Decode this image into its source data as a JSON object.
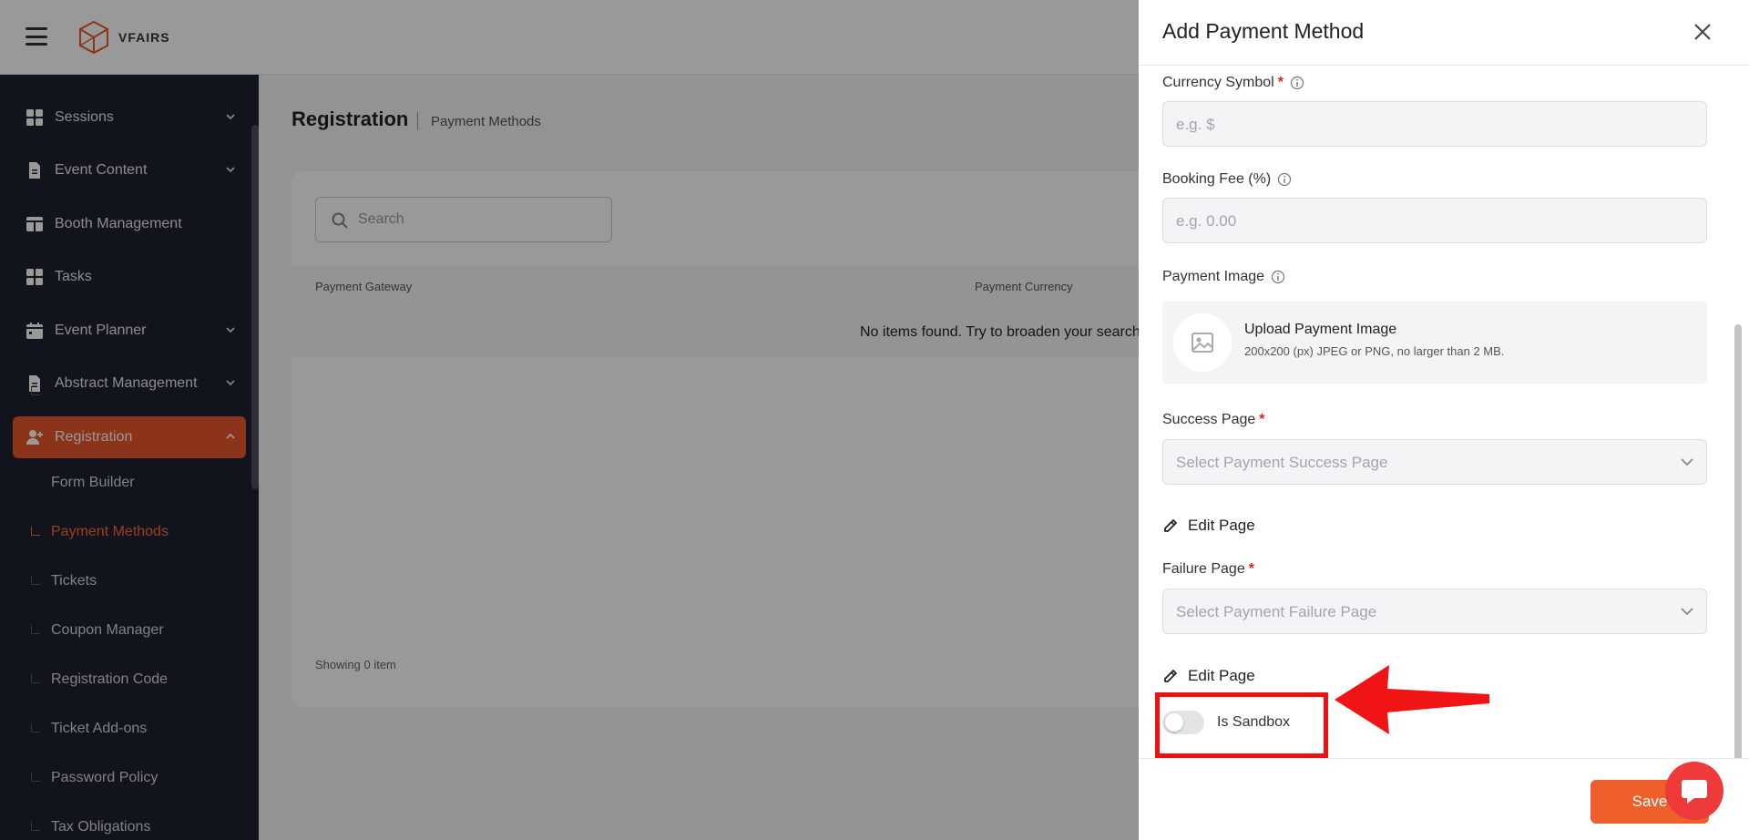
{
  "brand": {
    "logo_text": "VFAIRS"
  },
  "sidebar": {
    "items": [
      {
        "label": "Sessions",
        "icon": "grid-icon"
      },
      {
        "label": "Event Content",
        "icon": "document-icon"
      },
      {
        "label": "Booth Management",
        "icon": "booth-icon"
      },
      {
        "label": "Tasks",
        "icon": "grid-icon"
      },
      {
        "label": "Event Planner",
        "icon": "calendar-icon"
      },
      {
        "label": "Abstract Management",
        "icon": "document-icon"
      },
      {
        "label": "Registration",
        "icon": "user-plus-icon"
      }
    ],
    "sub_items": [
      {
        "label": "Form Builder"
      },
      {
        "label": "Payment Methods"
      },
      {
        "label": "Tickets"
      },
      {
        "label": "Coupon Manager"
      },
      {
        "label": "Registration Code"
      },
      {
        "label": "Ticket Add-ons"
      },
      {
        "label": "Password Policy"
      },
      {
        "label": "Tax Obligations"
      }
    ]
  },
  "main": {
    "title": "Registration",
    "breadcrumb": "Payment Methods",
    "search_placeholder": "Search",
    "columns": [
      "Payment Gateway",
      "Payment Currency"
    ],
    "empty_message": "No items found. Try to broaden your search",
    "showing": "Showing 0 item"
  },
  "drawer": {
    "title": "Add Payment Method",
    "currency_symbol": {
      "label": "Currency Symbol",
      "placeholder": "e.g. $"
    },
    "booking_fee": {
      "label": "Booking Fee (%)",
      "placeholder": "e.g. 0.00"
    },
    "payment_image": {
      "label": "Payment Image",
      "upload_title": "Upload Payment Image",
      "upload_hint": "200x200 (px) JPEG or PNG, no larger than 2 MB."
    },
    "success_page": {
      "label": "Success Page",
      "placeholder": "Select Payment Success Page"
    },
    "failure_page": {
      "label": "Failure Page",
      "placeholder": "Select Payment Failure Page"
    },
    "edit_page_label": "Edit Page",
    "sandbox": {
      "label": "Is Sandbox",
      "enabled": false
    },
    "save_label": "Save"
  },
  "colors": {
    "accent": "#e8582a",
    "sidebar_bg": "#1d2230",
    "annotation_red": "#ee1111"
  }
}
